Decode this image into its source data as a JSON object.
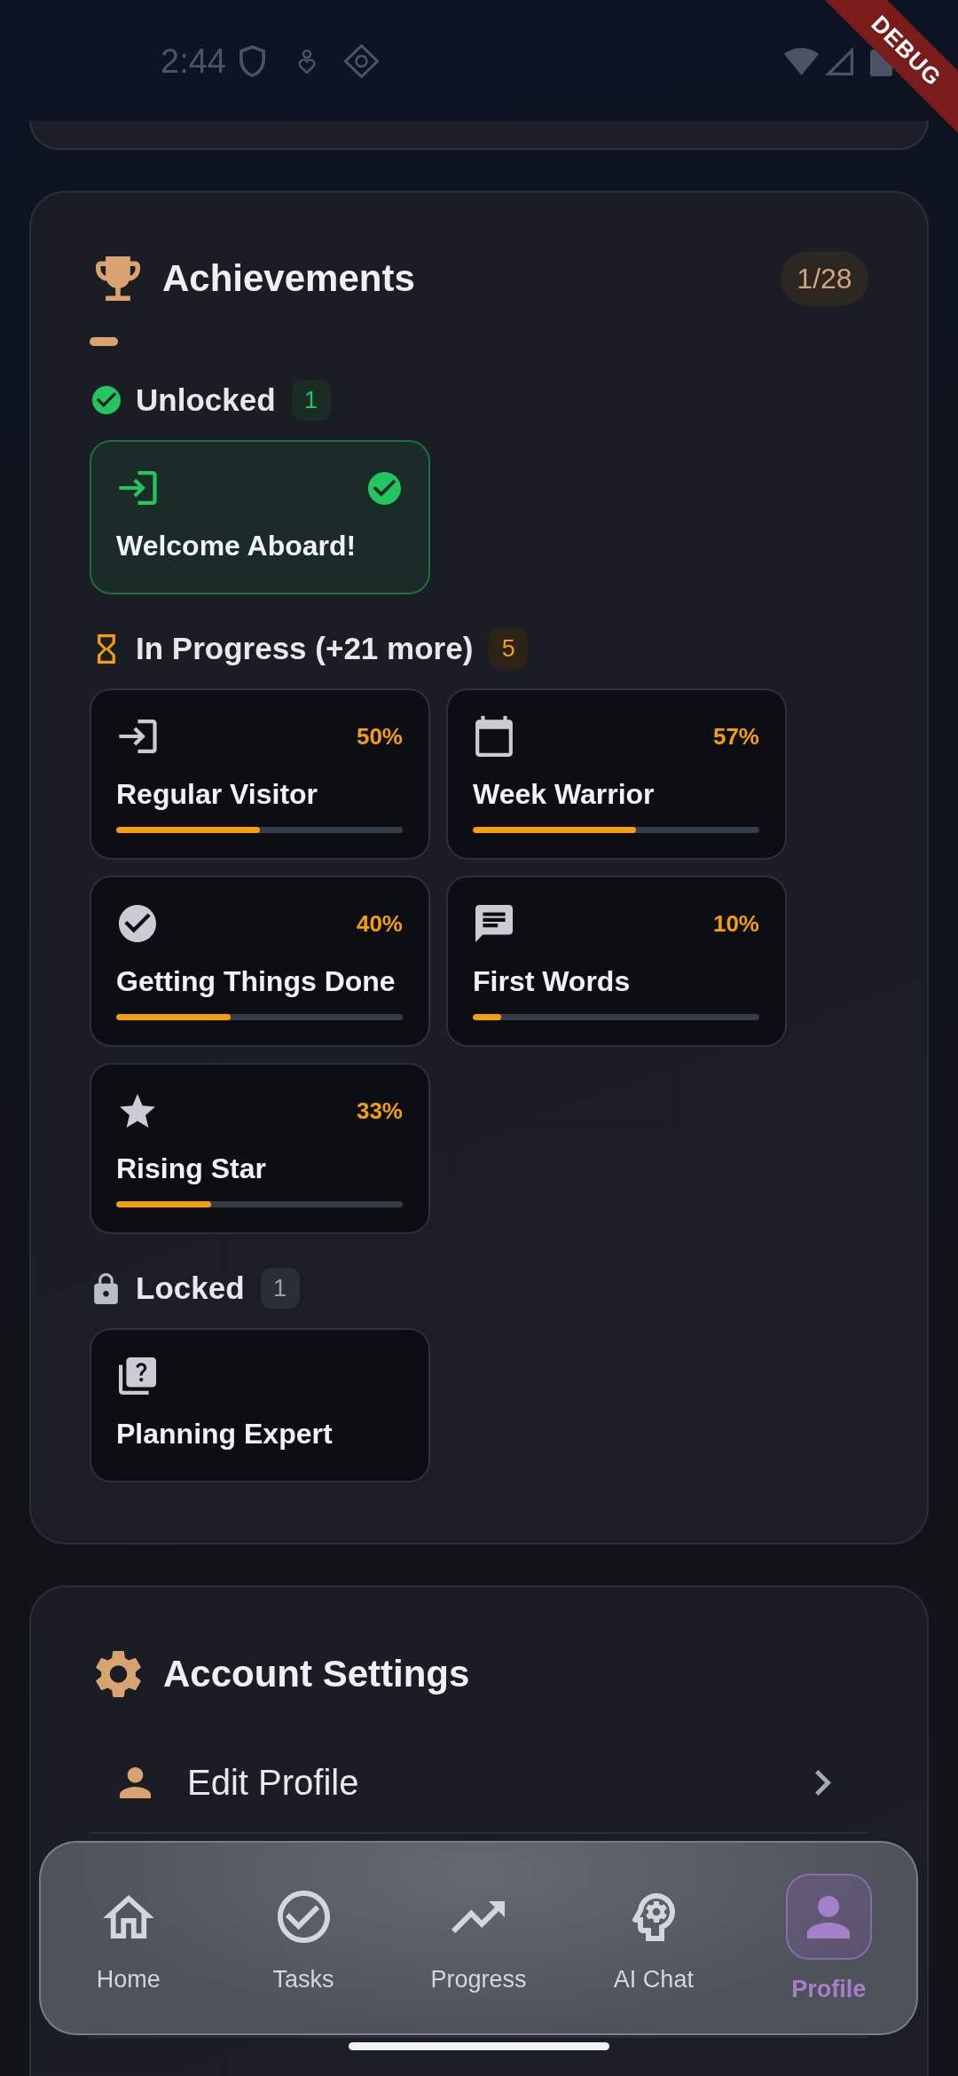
{
  "status_bar": {
    "time": "2:44"
  },
  "debug_banner": {
    "label": "DEBUG"
  },
  "achievements": {
    "title": "Achievements",
    "count": "1/28",
    "groups": [
      {
        "kind": "unlocked",
        "label": "Unlocked",
        "count": "1",
        "items": [
          {
            "name": "Welcome Aboard!"
          }
        ]
      },
      {
        "kind": "progress",
        "label": "In Progress (+21 more)",
        "count": "5",
        "items": [
          {
            "name": "Regular Visitor",
            "percent": "50%",
            "level": 0.5
          },
          {
            "name": "Week Warrior",
            "percent": "57%",
            "level": 0.57
          },
          {
            "name": "Getting Things Done",
            "percent": "40%",
            "level": 0.4
          },
          {
            "name": "First Words",
            "percent": "10%",
            "level": 0.1
          },
          {
            "name": "Rising Star",
            "percent": "33%",
            "level": 0.33
          }
        ]
      },
      {
        "kind": "locked",
        "label": "Locked",
        "count": "1",
        "items": [
          {
            "name": "Planning Expert"
          }
        ]
      }
    ]
  },
  "account_settings": {
    "title": "Account Settings",
    "items": [
      {
        "label": "Edit Profile"
      }
    ]
  },
  "bottom_nav": [
    {
      "label": "Home",
      "selected": false
    },
    {
      "label": "Tasks",
      "selected": false
    },
    {
      "label": "Progress",
      "selected": false
    },
    {
      "label": "AI Chat",
      "selected": false
    },
    {
      "label": "Profile",
      "selected": true
    }
  ]
}
